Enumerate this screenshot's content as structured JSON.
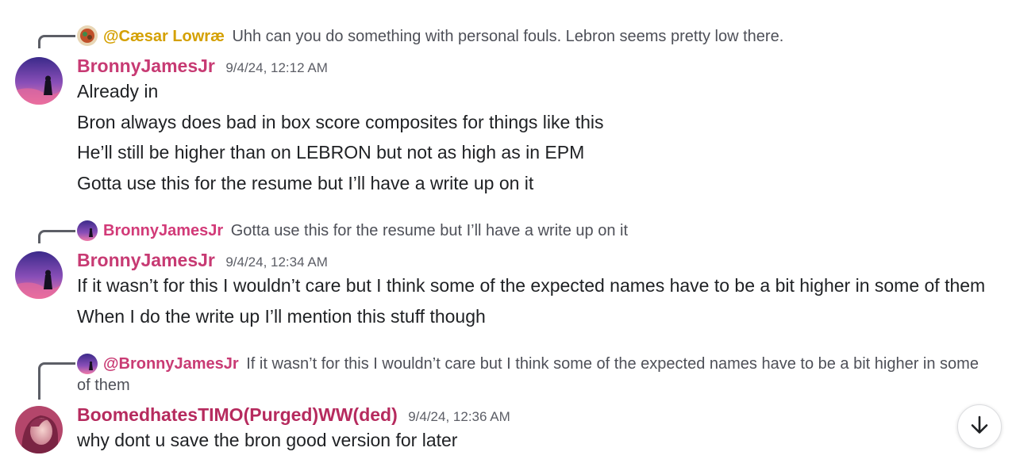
{
  "messages": [
    {
      "reply": {
        "author": "@Cæsar Lowræ",
        "text": "Uhh can you do something with personal fouls. Lebron seems pretty low there."
      },
      "author": "BronnyJamesJr",
      "timestamp": "9/4/24, 12:12 AM",
      "lines": [
        "Already in",
        "Bron always does bad in box score composites for things like this",
        "He’ll still be higher than on LEBRON but not as high as in EPM",
        "Gotta use this for the resume but I’ll have a write up on it"
      ]
    },
    {
      "reply": {
        "author": "BronnyJamesJr",
        "text": "Gotta use this for the resume but I’ll have a write up on it"
      },
      "author": "BronnyJamesJr",
      "timestamp": "9/4/24, 12:34 AM",
      "lines": [
        "If it wasn’t for this I wouldn’t care but I think some of the expected names have to be a bit higher in some of them",
        "When I do the write up I’ll mention this stuff though"
      ]
    },
    {
      "reply": {
        "author": "@BronnyJamesJr",
        "text": "If it wasn’t for this I wouldn’t care but I think some of the expected names have to be a bit higher in some of them"
      },
      "author": "BoomedhatesTIMO(Purged)WW(ded)",
      "timestamp": "9/4/24, 12:36 AM",
      "lines": [
        "why dont u save the bron good version for later"
      ]
    }
  ],
  "scroll_button": {
    "icon": "arrow-down-icon"
  },
  "colors": {
    "username": "#c73a73",
    "reply_mention_gold": "#d4a000",
    "timestamp": "#5c5e66",
    "text": "#1f2124"
  }
}
